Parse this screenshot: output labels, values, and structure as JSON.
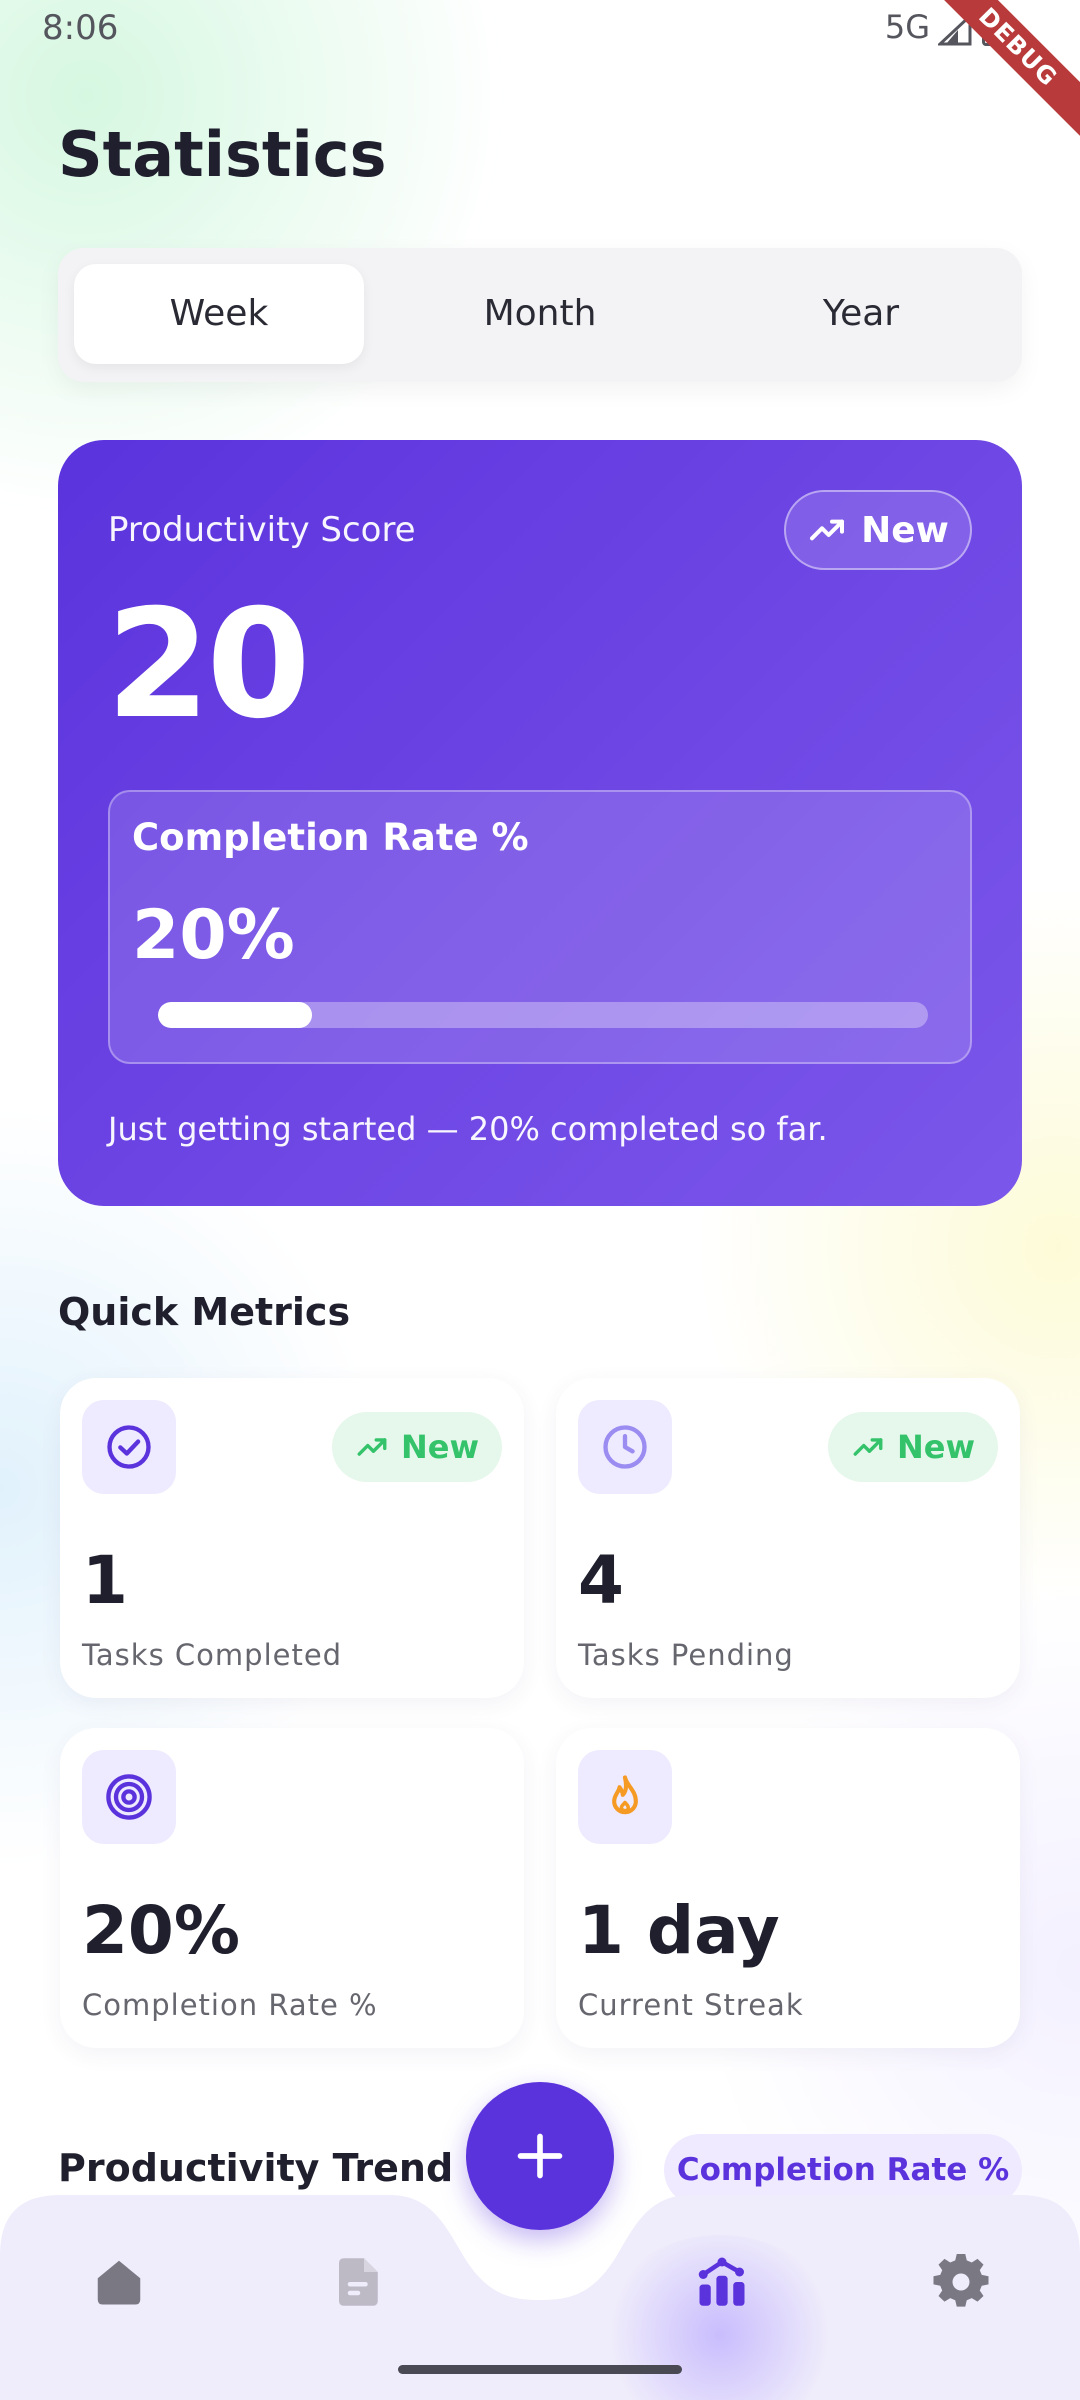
{
  "status_bar": {
    "time": "8:06",
    "network": "5G"
  },
  "debug_banner": "DEBUG",
  "page": {
    "title": "Statistics"
  },
  "period_tabs": [
    {
      "label": "Week",
      "selected": true
    },
    {
      "label": "Month",
      "selected": false
    },
    {
      "label": "Year",
      "selected": false
    }
  ],
  "score_card": {
    "label": "Productivity Score",
    "trend_label": "New",
    "score": "20",
    "completion": {
      "label": "Completion Rate %",
      "value": "20%",
      "progress": 0.2
    },
    "note": "Just getting started —  20% completed so far."
  },
  "quick_metrics": {
    "title": "Quick Metrics",
    "cards": [
      {
        "icon": "check-circle-icon",
        "badge": "New",
        "value": "1",
        "label": "Tasks Completed"
      },
      {
        "icon": "clock-icon",
        "badge": "New",
        "value": "4",
        "label": "Tasks Pending"
      },
      {
        "icon": "target-icon",
        "badge": "",
        "value": "20%",
        "label": "Completion Rate %"
      },
      {
        "icon": "flame-icon",
        "badge": "",
        "value": "1 day",
        "label": "Current Streak"
      }
    ]
  },
  "trend_section": {
    "title": "Productivity Trend",
    "metric_chip": "Completion Rate %"
  },
  "bottom_nav": {
    "items": [
      "home-icon",
      "document-icon",
      "statistics-icon",
      "settings-icon"
    ],
    "active": "statistics-icon"
  },
  "colors": {
    "accent": "#5b33dd",
    "badge_green": "#34c36a",
    "flame_orange": "#f59a23",
    "nav_inactive": "#7a7882"
  }
}
